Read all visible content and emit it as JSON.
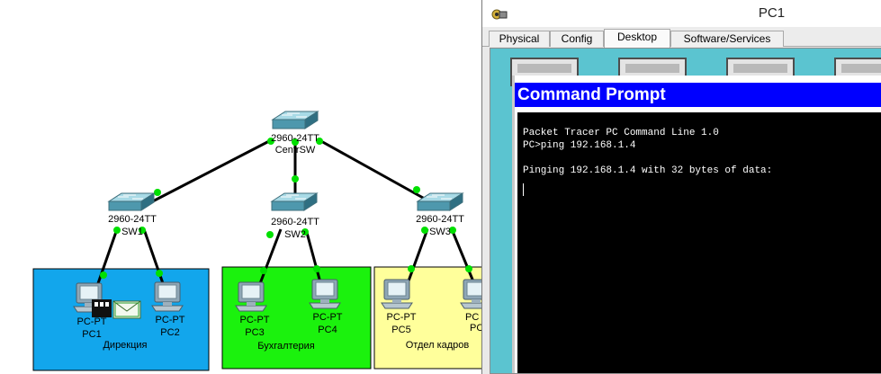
{
  "topology": {
    "switches": [
      {
        "model": "2960-24TT",
        "name": "CentrSW"
      },
      {
        "model": "2960-24TT",
        "name": "SW1"
      },
      {
        "model": "2960-24TT",
        "name": "SW2"
      },
      {
        "model": "2960-24TT",
        "name": "SW3"
      }
    ],
    "pcs": [
      {
        "type": "PC-PT",
        "name": "PC1"
      },
      {
        "type": "PC-PT",
        "name": "PC2"
      },
      {
        "type": "PC-PT",
        "name": "PC3"
      },
      {
        "type": "PC-PT",
        "name": "PC4"
      },
      {
        "type": "PC-PT",
        "name": "PC5"
      },
      {
        "type": "PC",
        "name": "PC"
      }
    ],
    "areas": [
      {
        "label": "Дирекция",
        "color": "#12a6ec"
      },
      {
        "label": "Бухгалтерия",
        "color": "#1bf20d"
      },
      {
        "label": "Отдел кадров",
        "color": "#ffff9b"
      }
    ],
    "link_color": "#000000",
    "port_color": "#00e000"
  },
  "window": {
    "title": "PC1",
    "tabs": [
      "Physical",
      "Config",
      "Desktop",
      "Software/Services"
    ],
    "active_tab": "Desktop"
  },
  "command_prompt": {
    "title": "Command Prompt",
    "lines": [
      "Packet Tracer PC Command Line 1.0",
      "PC>ping 192.168.1.4",
      "",
      "Pinging 192.168.1.4 with 32 bytes of data:"
    ]
  }
}
